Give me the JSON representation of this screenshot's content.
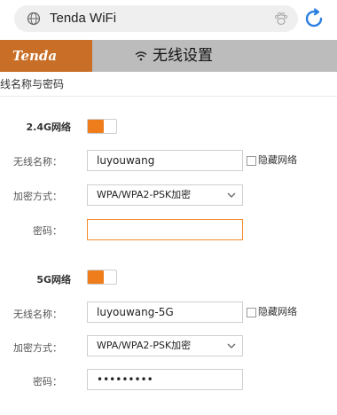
{
  "browser": {
    "address_title": "Tenda WiFi"
  },
  "banner": {
    "logo": "Tenda",
    "title": "无线设置"
  },
  "section": {
    "title": "无线名称与密码"
  },
  "band_24": {
    "label": "2.4G网络",
    "enabled": true,
    "ssid_label": "无线名称：",
    "ssid_value": "luyouwang",
    "hide_label": "隐藏网络",
    "hidden": false,
    "security_label": "加密方式：",
    "security_value": "WPA/WPA2-PSK加密",
    "password_label": "密码：",
    "password_value": ""
  },
  "band_5": {
    "label": "5G网络",
    "enabled": true,
    "ssid_label": "无线名称：",
    "ssid_value": "luyouwang-5G",
    "hide_label": "隐藏网络",
    "hidden": false,
    "security_label": "加密方式：",
    "security_value": "WPA/WPA2-PSK加密",
    "password_label": "密码：",
    "password_value": "•••••••••"
  },
  "colors": {
    "accent": "#f07d1c",
    "logo_bg": "#c86e26"
  }
}
